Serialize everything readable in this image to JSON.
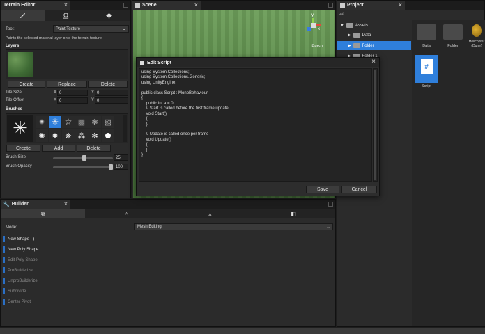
{
  "terrain": {
    "title": "Terrain Editor",
    "tool_label": "Tool:",
    "tool_value": "Paint Texture",
    "description": "Paints the selected material layer onto the terrain texture.",
    "layers_label": "Layers",
    "btn_create": "Create",
    "btn_replace": "Replace",
    "btn_delete": "Delete",
    "tile_size_label": "Tile Size",
    "tile_offset_label": "Tile Offset",
    "x_label": "X",
    "y_label": "Y",
    "tile_size_x": "0",
    "tile_size_y": "0",
    "tile_offset_x": "0",
    "tile_offset_y": "0",
    "brushes_label": "Brushes",
    "brush_create": "Create",
    "brush_add": "Add",
    "brush_delete": "Delete",
    "brush_size_label": "Brush Size",
    "brush_size_value": "25",
    "brush_size_level": 0.52,
    "brush_opacity_label": "Brush Opacity",
    "brush_opacity_value": "100",
    "brush_opacity_level": 1.0
  },
  "scene": {
    "title": "Scene",
    "gizmo_y": "y",
    "gizmo_x": "x",
    "persp": "Persp"
  },
  "project": {
    "title": "Project",
    "search": "All",
    "tree": {
      "assets": "Assets",
      "data": "Data",
      "folder": "Folder",
      "folder1": "Folder 1"
    },
    "items": {
      "data": "Data",
      "folder": "Folder",
      "helicopter": "Helicopter (Dune)",
      "script": "Script"
    }
  },
  "dialog": {
    "title": "Edit Script",
    "code": "using System.Collections;\nusing System.Collections.Generic;\nusing UnityEngine;\n\npublic class Script : MonoBehaviour\n{\n    public int a = 0;\n    // Start is called before the first frame update\n    void Start()\n    {\n    }\n\n    // Update is called once per frame\n    void Update()\n    {\n    }\n}",
    "save": "Save",
    "cancel": "Cancel"
  },
  "builder": {
    "title": "Builder",
    "mode_label": "Mode:",
    "mode_value": "Mesh Editing",
    "items": [
      "New Shape",
      "New Poly Shape",
      "Edit Poly Shape",
      "ProBuilderize",
      "UnproBuilderize",
      "Subdivide",
      "Center Pivot"
    ]
  }
}
